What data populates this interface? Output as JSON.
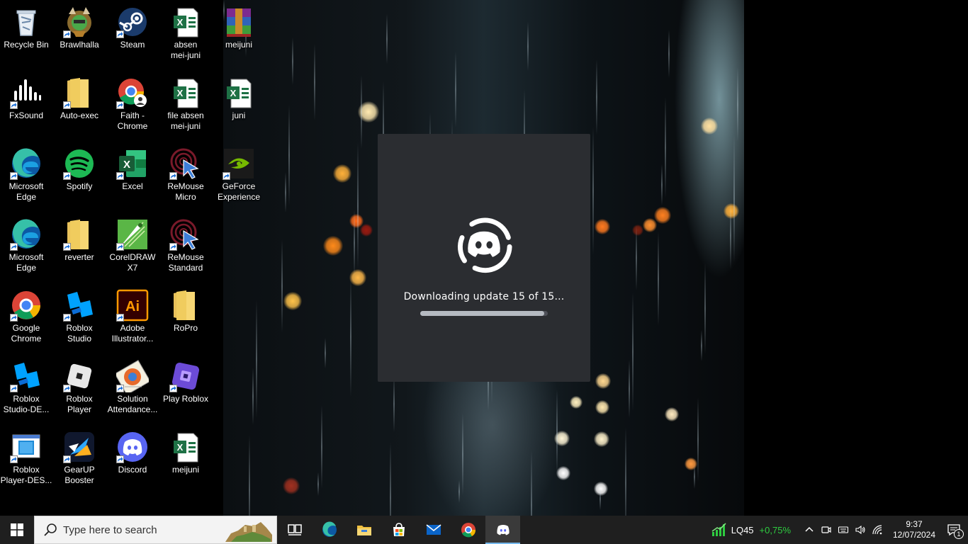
{
  "desktop": {
    "icons": [
      {
        "label": "Recycle Bin",
        "icon": "recycle-bin-icon"
      },
      {
        "label": "Brawlhalla",
        "icon": "brawlhalla-icon"
      },
      {
        "label": "Steam",
        "icon": "steam-icon"
      },
      {
        "label": "absen\nmei-juni",
        "icon": "excel-file-icon"
      },
      {
        "label": "meijuni",
        "icon": "winrar-archive-icon"
      },
      {
        "label": "FxSound",
        "icon": "fxsound-icon"
      },
      {
        "label": "Auto-exec",
        "icon": "folder-icon"
      },
      {
        "label": "Faith -\nChrome",
        "icon": "chrome-profile-icon"
      },
      {
        "label": "file absen\nmei-juni",
        "icon": "excel-file-icon"
      },
      {
        "label": "juni",
        "icon": "excel-file-icon"
      },
      {
        "label": "Microsoft\nEdge",
        "icon": "edge-icon"
      },
      {
        "label": "Spotify",
        "icon": "spotify-icon"
      },
      {
        "label": "Excel",
        "icon": "excel-icon"
      },
      {
        "label": "ReMouse\nMicro",
        "icon": "remouse-icon"
      },
      {
        "label": "GeForce\nExperience",
        "icon": "geforce-icon"
      },
      {
        "label": "Microsoft\nEdge",
        "icon": "edge-icon"
      },
      {
        "label": "reverter",
        "icon": "folder-icon"
      },
      {
        "label": "CorelDRAW\nX7",
        "icon": "coreldraw-icon"
      },
      {
        "label": "ReMouse\nStandard",
        "icon": "remouse-icon"
      },
      {
        "label": "Google\nChrome",
        "icon": "chrome-icon"
      },
      {
        "label": "Roblox\nStudio",
        "icon": "roblox-studio-icon"
      },
      {
        "label": "Adobe\nIllustrator...",
        "icon": "illustrator-icon"
      },
      {
        "label": "RoPro",
        "icon": "folder-icon"
      },
      {
        "label": "Roblox\nStudio-DE...",
        "icon": "roblox-studio-icon"
      },
      {
        "label": "Roblox\nPlayer",
        "icon": "roblox-player-icon"
      },
      {
        "label": "Solution\nAttendance...",
        "icon": "solution-attendance-icon"
      },
      {
        "label": "Play Roblox",
        "icon": "play-roblox-icon"
      },
      {
        "label": "Roblox\nPlayer-DES...",
        "icon": "roblox-player-installer-icon"
      },
      {
        "label": "GearUP\nBooster",
        "icon": "gearup-icon"
      },
      {
        "label": "Discord",
        "icon": "discord-icon"
      },
      {
        "label": "meijuni",
        "icon": "excel-file-icon"
      }
    ]
  },
  "splash": {
    "app": "Discord",
    "logo_icon": "discord-updater-logo-icon",
    "status": "Downloading update 15 of 15...",
    "progress": 0.97
  },
  "taskbar": {
    "search_placeholder": "Type here to search",
    "apps": [
      {
        "name": "Task View",
        "icon": "task-view-icon"
      },
      {
        "name": "Microsoft Edge",
        "icon": "edge-icon"
      },
      {
        "name": "File Explorer",
        "icon": "file-explorer-icon"
      },
      {
        "name": "Microsoft Store",
        "icon": "store-icon"
      },
      {
        "name": "Mail",
        "icon": "mail-icon"
      },
      {
        "name": "Google Chrome",
        "icon": "chrome-icon"
      },
      {
        "name": "Discord",
        "icon": "discord-icon",
        "active": true
      }
    ],
    "stock": {
      "symbol": "LQ45",
      "change": "+0,75%"
    },
    "clock": {
      "time": "9:37",
      "date": "12/07/2024"
    },
    "notification_count": "1"
  },
  "colors": {
    "taskbar": "#1f1f1f",
    "splash_bg": "#2b2d31",
    "stock_up": "#2ecc40",
    "active_indicator": "#76b9ed"
  }
}
